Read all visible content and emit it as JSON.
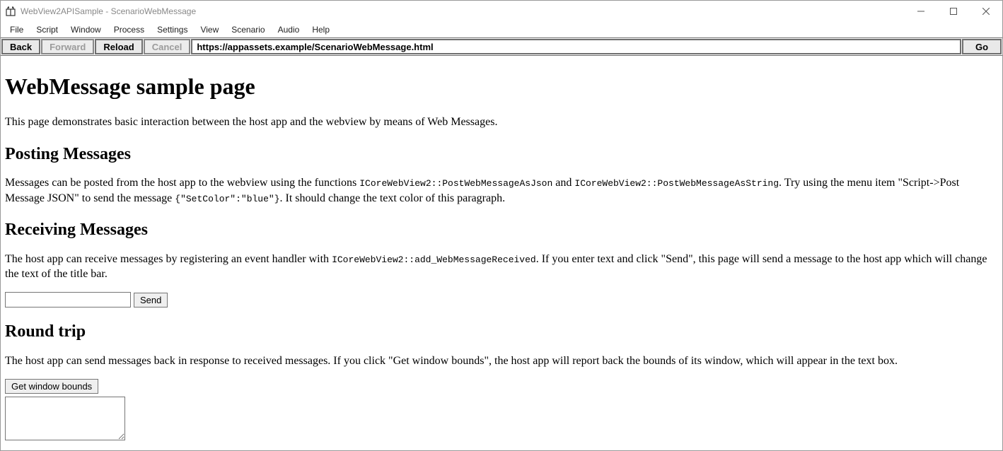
{
  "window": {
    "title": "WebView2APISample - ScenarioWebMessage"
  },
  "menu": {
    "items": [
      "File",
      "Script",
      "Window",
      "Process",
      "Settings",
      "View",
      "Scenario",
      "Audio",
      "Help"
    ]
  },
  "nav": {
    "back": "Back",
    "forward": "Forward",
    "reload": "Reload",
    "cancel": "Cancel",
    "url": "https://appassets.example/ScenarioWebMessage.html",
    "go": "Go"
  },
  "page": {
    "h1": "WebMessage sample page",
    "intro": "This page demonstrates basic interaction between the host app and the webview by means of Web Messages.",
    "posting": {
      "heading": "Posting Messages",
      "p_before_code1": "Messages can be posted from the host app to the webview using the functions ",
      "code1": "ICoreWebView2::PostWebMessageAsJson",
      "p_mid1": " and ",
      "code2": "ICoreWebView2::PostWebMessageAsString",
      "p_after_code2": ". Try using the menu item \"Script->Post Message JSON\" to send the message ",
      "code3": "{\"SetColor\":\"blue\"}",
      "p_end": ". It should change the text color of this paragraph."
    },
    "receiving": {
      "heading": "Receiving Messages",
      "p_before_code": "The host app can receive messages by registering an event handler with ",
      "code1": "ICoreWebView2::add_WebMessageReceived",
      "p_after_code": ". If you enter text and click \"Send\", this page will send a message to the host app which will change the text of the title bar.",
      "send_label": "Send"
    },
    "roundtrip": {
      "heading": "Round trip",
      "p": "The host app can send messages back in response to received messages. If you click \"Get window bounds\", the host app will report back the bounds of its window, which will appear in the text box.",
      "button_label": "Get window bounds"
    }
  }
}
